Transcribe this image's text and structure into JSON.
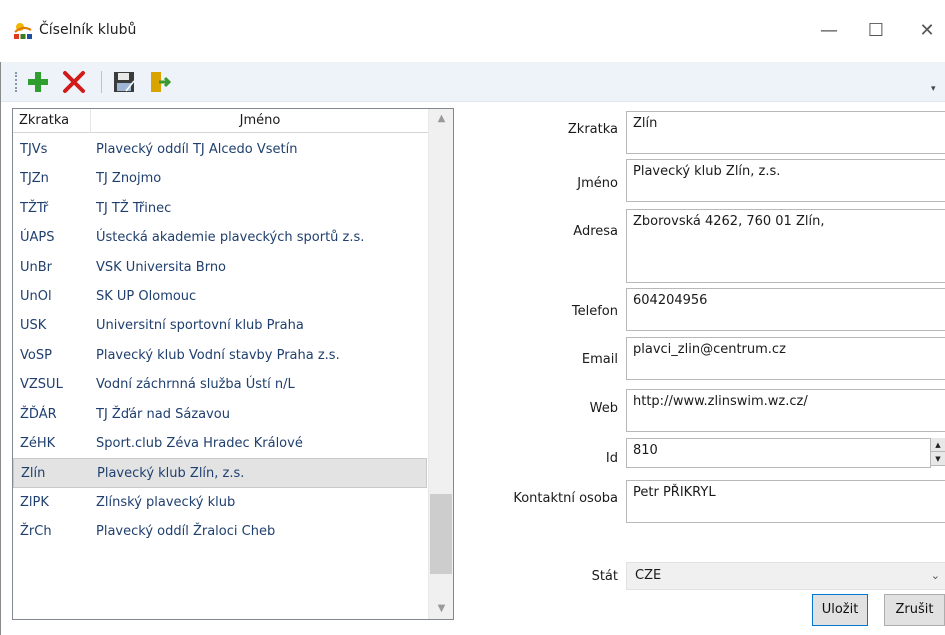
{
  "window": {
    "title": "Číselník klubů",
    "controls": {
      "minimize": "—",
      "maximize": "☐",
      "close": "✕"
    }
  },
  "toolbar": {
    "items": [
      {
        "icon": "add-icon",
        "color": "#2e9e2e"
      },
      {
        "icon": "delete-icon",
        "color": "#d11a1a"
      },
      {
        "icon": "save-icon"
      },
      {
        "icon": "exit-icon"
      }
    ]
  },
  "list": {
    "headers": {
      "code": "Zkratka",
      "name": "Jméno"
    },
    "rows": [
      {
        "code": "TJVs",
        "name": "Plavecký oddíl TJ Alcedo Vsetín"
      },
      {
        "code": "TJZn",
        "name": "TJ Znojmo"
      },
      {
        "code": "TŽTř",
        "name": "TJ TŽ Třinec"
      },
      {
        "code": "ÚAPS",
        "name": "Ústecká akademie plaveckých sportů  z.s."
      },
      {
        "code": "UnBr",
        "name": "VSK Universita Brno"
      },
      {
        "code": "UnOl",
        "name": "SK UP Olomouc"
      },
      {
        "code": "USK",
        "name": "Universitní sportovní klub Praha"
      },
      {
        "code": "VoSP",
        "name": "Plavecký klub Vodní stavby Praha  z.s."
      },
      {
        "code": "VZSUL",
        "name": "Vodní záchrnná služba Ústí n/L"
      },
      {
        "code": "ŽĎÁR",
        "name": "TJ Žďár nad Sázavou"
      },
      {
        "code": "ZéHK",
        "name": "Sport.club Zéva Hradec Králové"
      },
      {
        "code": "Zlín",
        "name": "Plavecký klub Zlín, z.s.",
        "selected": true
      },
      {
        "code": "ZlPK",
        "name": "Zlínský plavecký klub"
      },
      {
        "code": "ŽrCh",
        "name": "Plavecký oddíl Žraloci Cheb"
      }
    ]
  },
  "form": {
    "labels": {
      "code": "Zkratka",
      "name": "Jméno",
      "address": "Adresa",
      "phone": "Telefon",
      "email": "Email",
      "web": "Web",
      "id": "Id",
      "contact": "Kontaktní osoba",
      "country": "Stát"
    },
    "values": {
      "code": "Zlín",
      "name": "Plavecký klub Zlín, z.s.",
      "address": "Zborovská 4262, 760 01 Zlín,",
      "phone": "604204956",
      "email": "plavci_zlin@centrum.cz",
      "web": "http://www.zlinswim.wz.cz/",
      "id": "810",
      "contact": "Petr PŘIKRYL",
      "country": "CZE"
    }
  },
  "buttons": {
    "save": "Uložit",
    "cancel": "Zrušit"
  }
}
